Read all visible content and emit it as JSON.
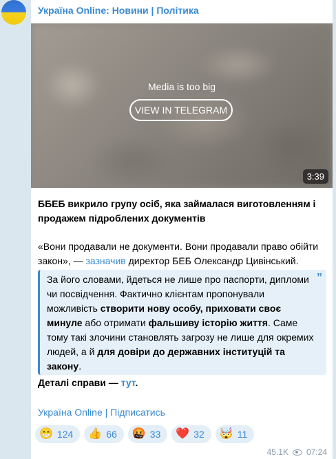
{
  "post": {
    "channel_title": "Україна Online: Новини | Політика",
    "media": {
      "notice": "Media is too big",
      "button_label": "VIEW IN TELEGRAM",
      "duration": "3:39"
    },
    "headline": "ББЕБ викрило групу осіб, яка займалася виготовленням і продажем підроблених документів",
    "quote_lead": "«Вони продавали не документи. Вони продавали право обійти закон», — ",
    "quote_link": "зазначив",
    "quote_tail": " директор БЕБ Олександр Цивінський.",
    "blockquote": {
      "part1": "За його словами, йдеться не лише про паспорти, дипломи чи посвідчення. Фактично клієнтам пропонували можливість ",
      "bold1": "створити нову особу, приховати своє минуле",
      "part2": " або отримати ",
      "bold2": "фальшиву історію життя",
      "part3": ". Саме тому такі злочини становлять загрозу не лише для окремих людей, а й ",
      "bold3": "для довіри до державних інституцій та закону",
      "part4": "."
    },
    "details_prefix": "Деталі справи — ",
    "details_link": "тут",
    "details_suffix": ".",
    "footer_link": "Україна Online | Підписатись",
    "reactions": [
      {
        "emoji": "😁",
        "count": "124"
      },
      {
        "emoji": "👍",
        "count": "66"
      },
      {
        "emoji": "🤬",
        "count": "33"
      },
      {
        "emoji": "❤️",
        "count": "32"
      },
      {
        "emoji": "🤯",
        "count": "11"
      }
    ],
    "views": "45.1K",
    "time": "07:24"
  },
  "colors": {
    "accent": "#3a8ad2",
    "background": "#dbe7ef",
    "quote_bg": "#e6f0f9"
  }
}
